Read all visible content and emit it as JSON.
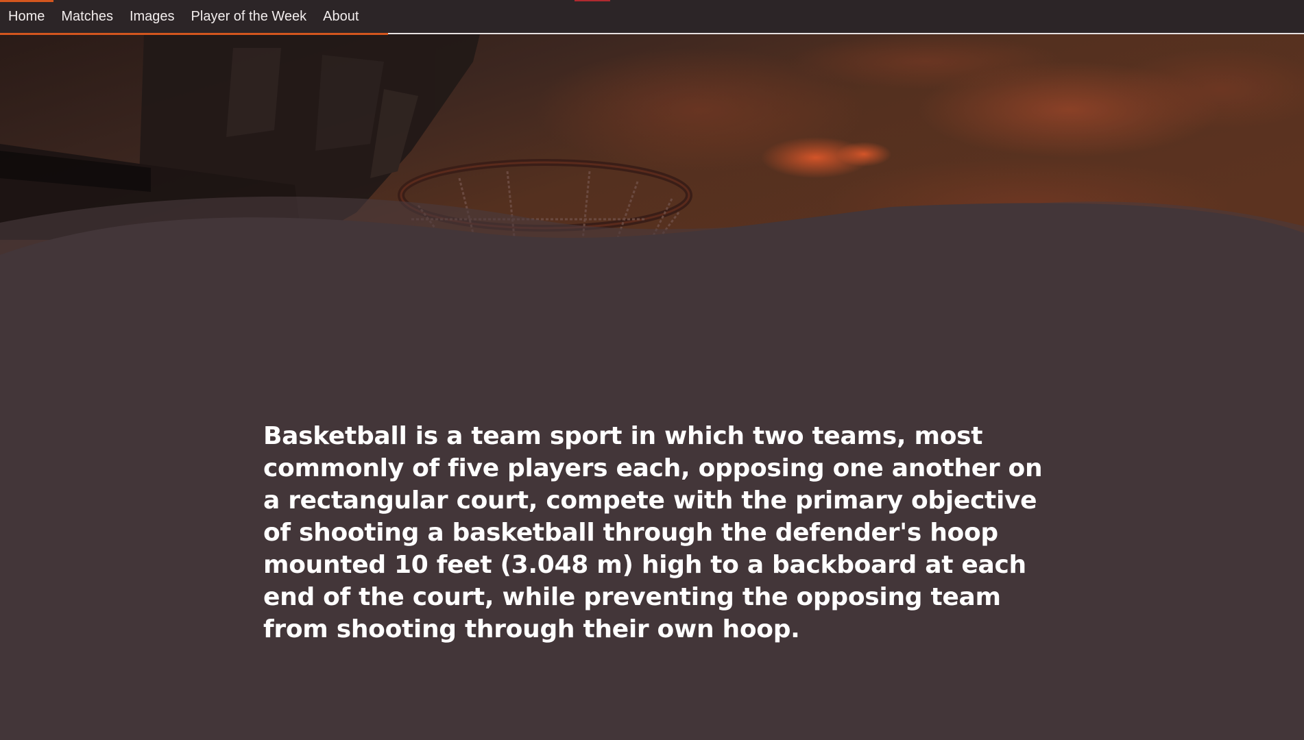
{
  "nav": {
    "items": [
      {
        "label": "Home",
        "active": true
      },
      {
        "label": "Matches"
      },
      {
        "label": "Images"
      },
      {
        "label": "Player of the Week"
      },
      {
        "label": "About"
      }
    ]
  },
  "hero": {
    "image": "basketball-hoop-sunset-sky"
  },
  "main": {
    "intro": "Basketball is a team sport in which two teams, most commonly of five players each, opposing one another on a rectangular court, compete with the primary objective of shooting a basketball through the defender's hoop mounted 10 feet (3.048 m) high to a backboard at each end of the court, while preventing the opposing team from shooting through their own hoop."
  },
  "colors": {
    "nav_background": "#2c2527",
    "accent": "#d3561e",
    "page_background": "#433639",
    "text": "#ffffff"
  }
}
